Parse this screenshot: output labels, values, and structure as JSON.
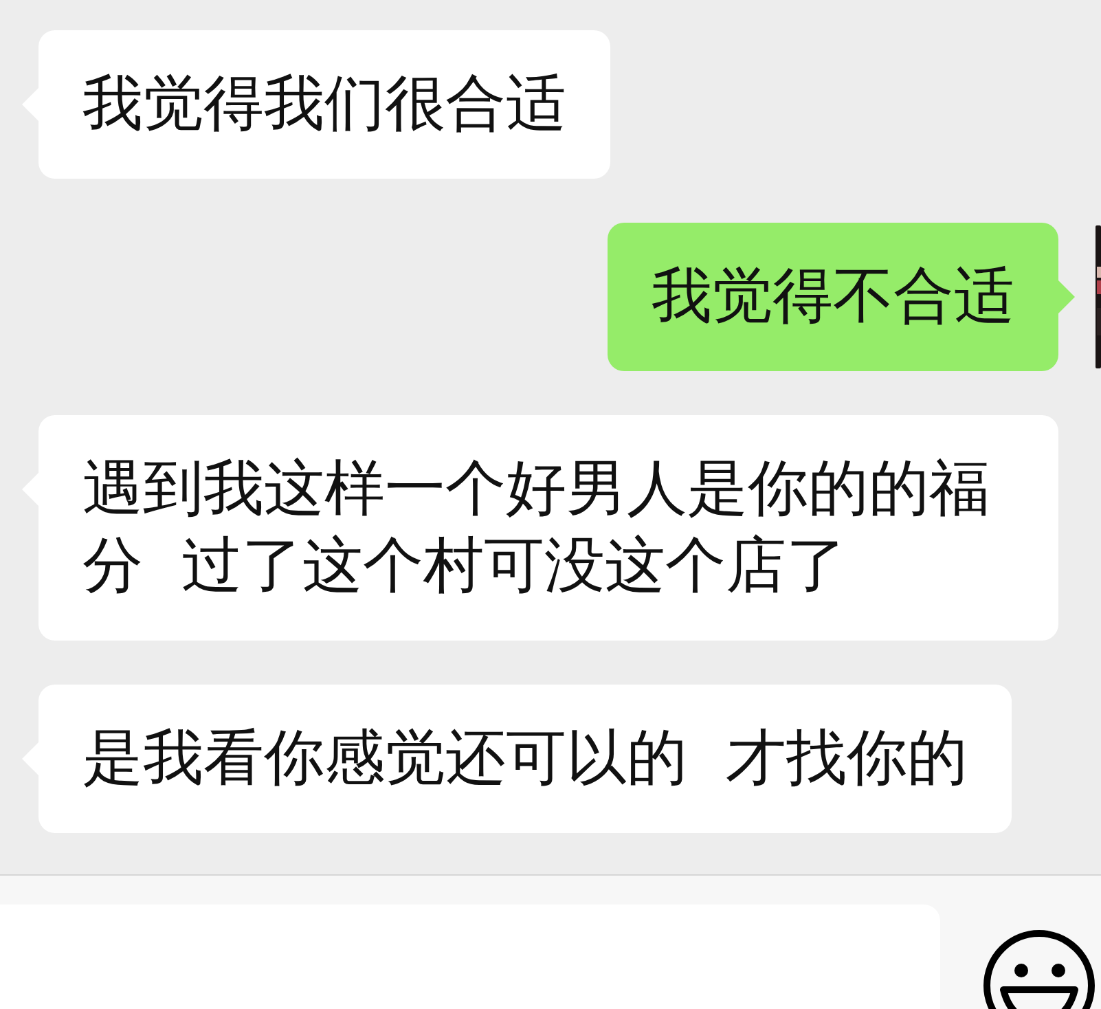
{
  "messages": [
    {
      "kind": "received",
      "text": "我觉得我们很合适"
    },
    {
      "kind": "sent",
      "text": "我觉得不合适"
    },
    {
      "kind": "received",
      "text": "遇到我这样一个好男人是你的的福分  过了这个村可没这个店了"
    },
    {
      "kind": "received",
      "text": "是我看你感觉还可以的  才找你的"
    }
  ]
}
